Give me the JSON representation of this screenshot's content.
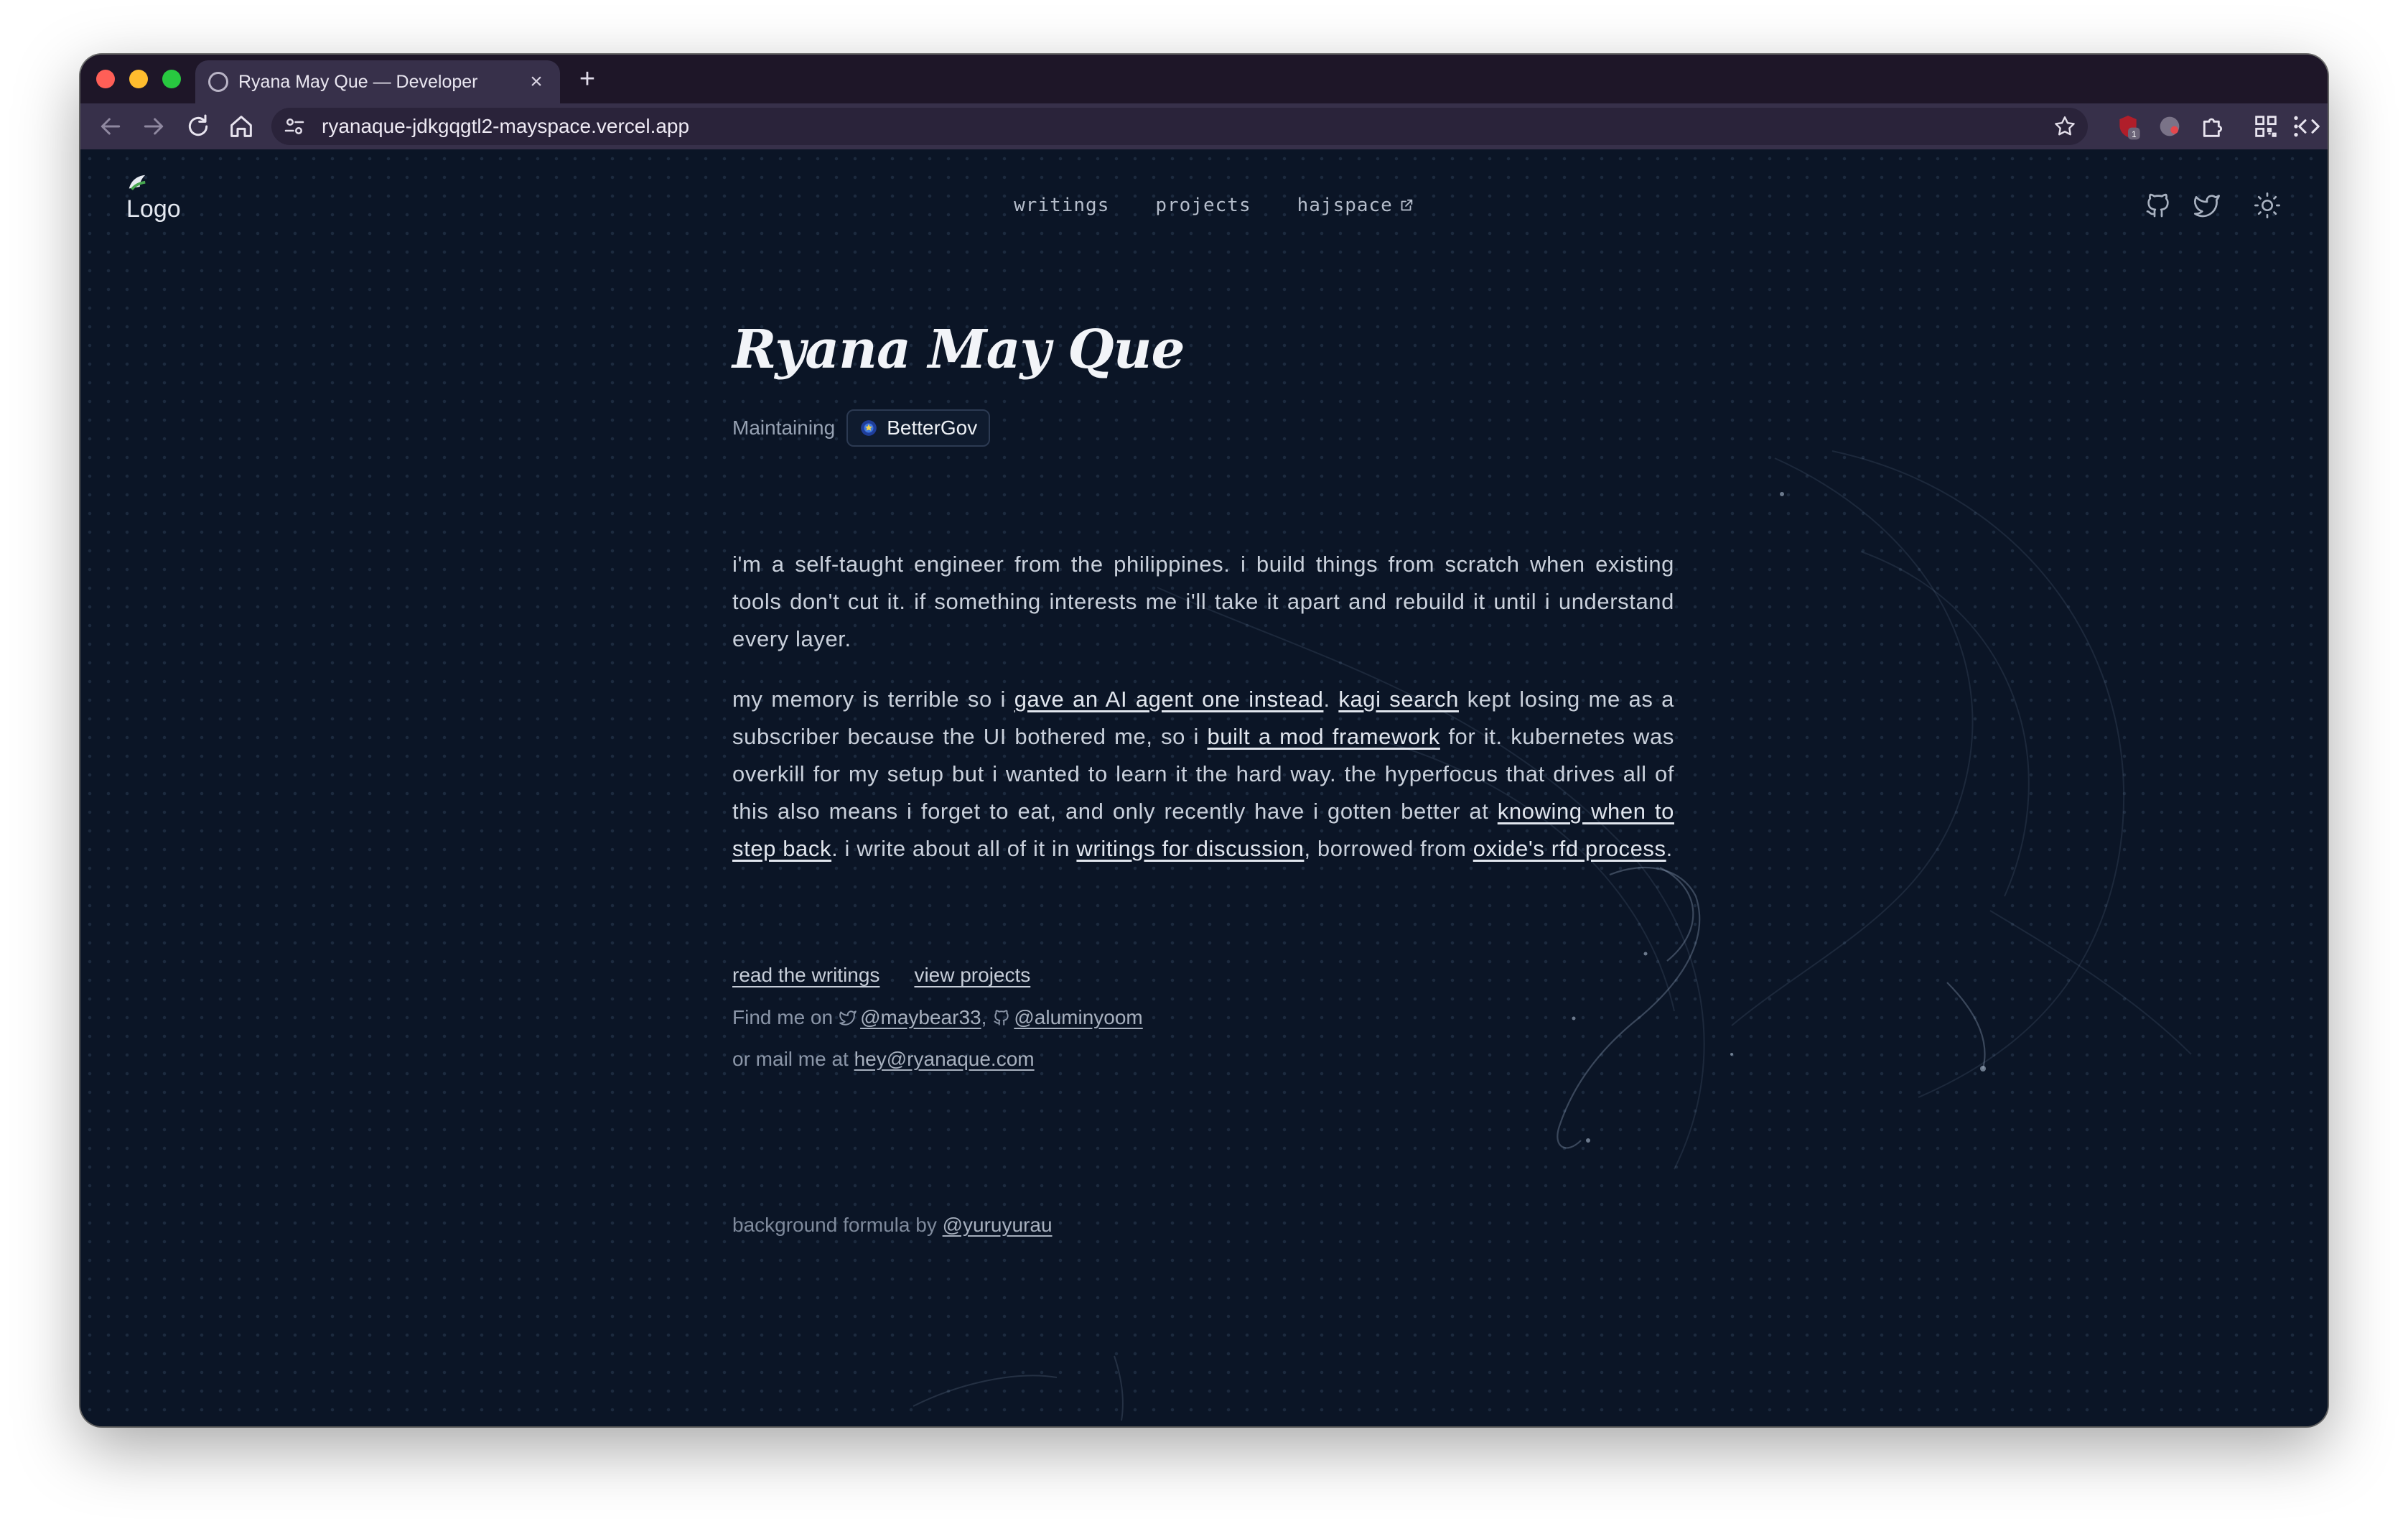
{
  "browser": {
    "tab": {
      "title": "Ryana May Que — Developer",
      "close_glyph": "×"
    },
    "new_tab_glyph": "+",
    "url": "ryanaque-jdkgqgtl2-mayspace.vercel.app",
    "extensions": [
      "ublock-icon",
      "avatar-extension-icon",
      "puzzle-icon",
      "qr-code-icon",
      "code-brackets-icon",
      "kebab-menu-icon"
    ],
    "extension_badge": "1"
  },
  "site": {
    "logo_alt": "Logo",
    "nav": [
      {
        "label": "writings"
      },
      {
        "label": "projects"
      },
      {
        "label": "hajspace"
      }
    ],
    "header_icons": [
      "github-icon",
      "twitter-icon",
      "theme-sun-icon"
    ]
  },
  "hero": {
    "name": "Ryana May Que",
    "maintaining_label": "Maintaining",
    "badge": "BetterGov"
  },
  "bio": {
    "p1": "i'm a self-taught engineer from the philippines. i build things from scratch when existing tools don't cut it. if something interests me i'll take it apart and rebuild it until i understand every layer.",
    "p2": {
      "t1": "my memory is terrible so i ",
      "l1": "gave an AI agent one instead",
      "t2": ". ",
      "l2": "kagi search",
      "t3": " kept losing me as a subscriber because the UI bothered me, so i ",
      "l3": "built a mod framework",
      "t4": " for it. kubernetes was overkill for my setup but i wanted to learn it the hard way. the hyperfocus that drives all of this also means i forget to eat, and only recently have i gotten better at ",
      "l4": "knowing when to step back",
      "t5": ". i write about all of it in ",
      "l5": "writings for discussion",
      "t6": ", borrowed from ",
      "l6": "oxide's rfd process",
      "t7": "."
    }
  },
  "cta": {
    "read": "read the writings",
    "projects": "view projects"
  },
  "contact": {
    "find_label": "Find me on",
    "twitter_handle": "@maybear33",
    "separator": ",",
    "github_handle": "@aluminyoom",
    "mail_label": "or mail me at",
    "email": "hey@ryanaque.com"
  },
  "footer": {
    "credit_label": "background formula by",
    "credit_handle": "@yuruyurau"
  },
  "colors": {
    "page_bg": "#0b1526",
    "tab_strip": "#1e1628",
    "toolbar": "#37304a",
    "text_primary": "#f2f4f8",
    "text_body": "#c9d0db",
    "text_muted": "#8b96a8"
  }
}
